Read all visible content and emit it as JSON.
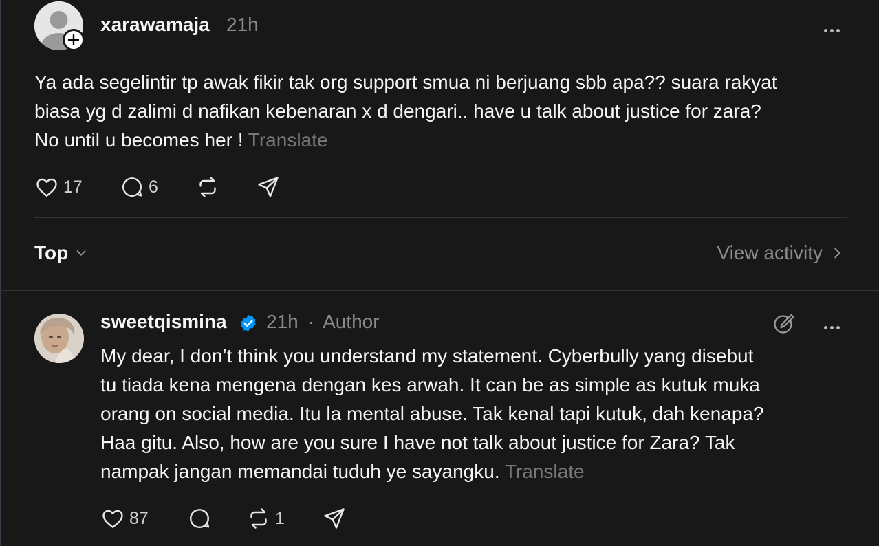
{
  "post": {
    "username": "xarawamaja",
    "time": "21h",
    "text": "Ya ada segelintir tp awak fikir tak org support smua ni berjuang sbb apa?? suara rakyat\nbiasa yg d zalimi d nafikan kebenaran x d dengari.. have u talk about justice for zara?\nNo until u becomes her !",
    "translate_label": "Translate",
    "likes": "17",
    "replies": "6"
  },
  "sort": {
    "label": "Top",
    "view_activity_label": "View activity"
  },
  "reply": {
    "username": "sweetqismina",
    "time": "21h",
    "separator": "·",
    "author_label": "Author",
    "text": "My dear, I don’t think you understand my statement. Cyberbully yang disebut\ntu tiada kena mengena dengan kes arwah. It can be as simple as kutuk muka\norang on social media. Itu la mental abuse. Tak kenal tapi kutuk, dah kenapa?\nHaa gitu. Also, how are you sure I have not talk about justice for Zara? Tak\nnampak jangan memandai tuduh ye sayangku.",
    "translate_label": "Translate",
    "likes": "87",
    "reposts": "1"
  },
  "colors": {
    "background": "#181818",
    "text": "#f3f5f7",
    "muted": "#8a8a8a",
    "verified": "#0095f6"
  }
}
